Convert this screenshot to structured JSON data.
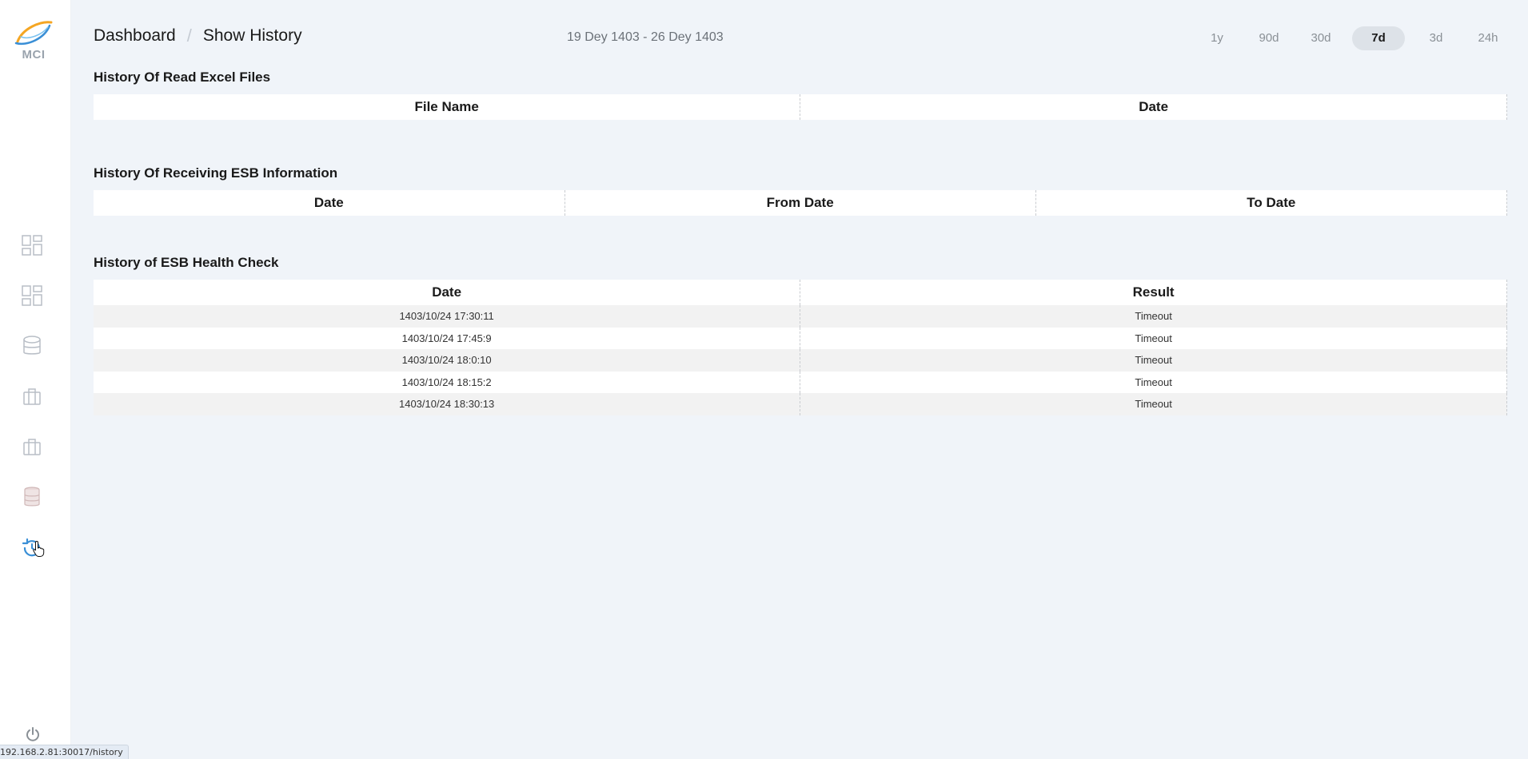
{
  "sidebar": {
    "logo_text": "MCI",
    "items": [
      {
        "icon": "dashboard-grid-icon"
      },
      {
        "icon": "dashboard-grid-icon"
      },
      {
        "icon": "database-icon"
      },
      {
        "icon": "briefcase-icon"
      },
      {
        "icon": "briefcase-icon"
      },
      {
        "icon": "stacked-database-icon"
      },
      {
        "icon": "history-icon",
        "active": true
      }
    ],
    "power_icon": "power-icon"
  },
  "status_url": "192.168.2.81:30017/history",
  "header": {
    "breadcrumb": [
      "Dashboard",
      "Show History"
    ],
    "date_range": "19 Dey 1403 - 26 Dey 1403",
    "ranges": [
      "1y",
      "90d",
      "30d",
      "7d",
      "3d",
      "24h"
    ],
    "active_range": "7d"
  },
  "sections": {
    "excel": {
      "title": "History Of Read Excel Files",
      "columns": [
        "File Name",
        "Date"
      ]
    },
    "esb_info": {
      "title": "History Of Receiving ESB Information",
      "columns": [
        "Date",
        "From Date",
        "To Date"
      ]
    },
    "health": {
      "title": "History of ESB Health Check",
      "columns": [
        "Date",
        "Result"
      ],
      "rows": [
        [
          "1403/10/24 17:30:11",
          "Timeout"
        ],
        [
          "1403/10/24 17:45:9",
          "Timeout"
        ],
        [
          "1403/10/24 18:0:10",
          "Timeout"
        ],
        [
          "1403/10/24 18:15:2",
          "Timeout"
        ],
        [
          "1403/10/24 18:30:13",
          "Timeout"
        ]
      ]
    }
  },
  "colors": {
    "accent": "#3a8fd6",
    "logo_orange": "#f5a623",
    "background": "#f0f4f9"
  }
}
